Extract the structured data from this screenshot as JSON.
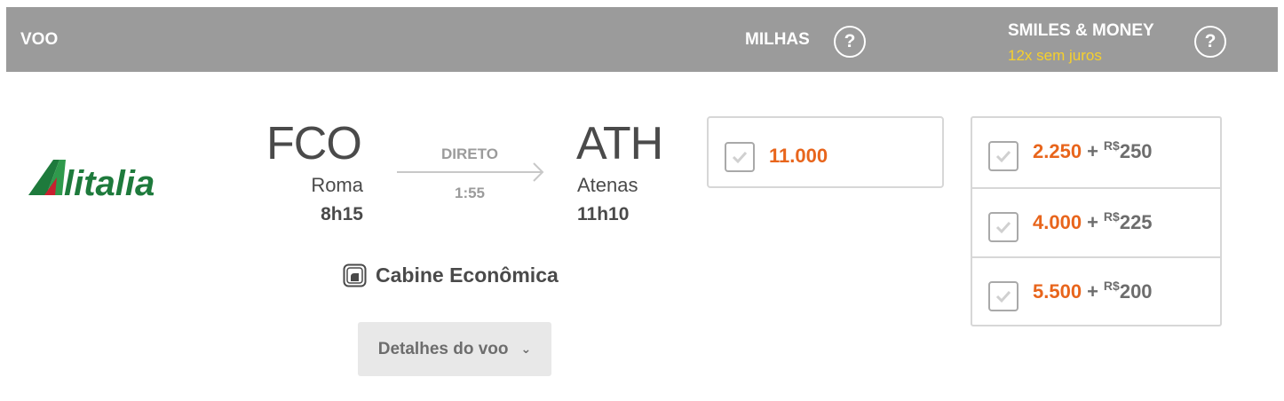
{
  "header": {
    "voo_label": "VOO",
    "milhas_label": "MILHAS",
    "help_glyph": "?",
    "smiles_label": "SMILES & MONEY",
    "installments_label": "12x sem juros"
  },
  "airline": {
    "name": "Alitalia",
    "logo_text": "Alitalia"
  },
  "flight": {
    "origin": {
      "code": "FCO",
      "city": "Roma",
      "time": "8h15"
    },
    "destination": {
      "code": "ATH",
      "city": "Atenas",
      "time": "11h10"
    },
    "stops_label": "DIRETO",
    "duration": "1:55",
    "cabin_label": "Cabine Econômica",
    "details_button": "Detalhes do voo"
  },
  "miles_option": {
    "value": "11.000"
  },
  "smiles_money_options": [
    {
      "miles": "2.250",
      "plus": "+",
      "currency": "R$",
      "money": "250"
    },
    {
      "miles": "4.000",
      "plus": "+",
      "currency": "R$",
      "money": "225"
    },
    {
      "miles": "5.500",
      "plus": "+",
      "currency": "R$",
      "money": "200"
    }
  ],
  "colors": {
    "header_bg": "#9b9b9b",
    "accent_orange": "#e8651c",
    "installments_yellow": "#f6d02c",
    "alitalia_green": "#1e7a3c",
    "alitalia_red": "#c8202f"
  }
}
